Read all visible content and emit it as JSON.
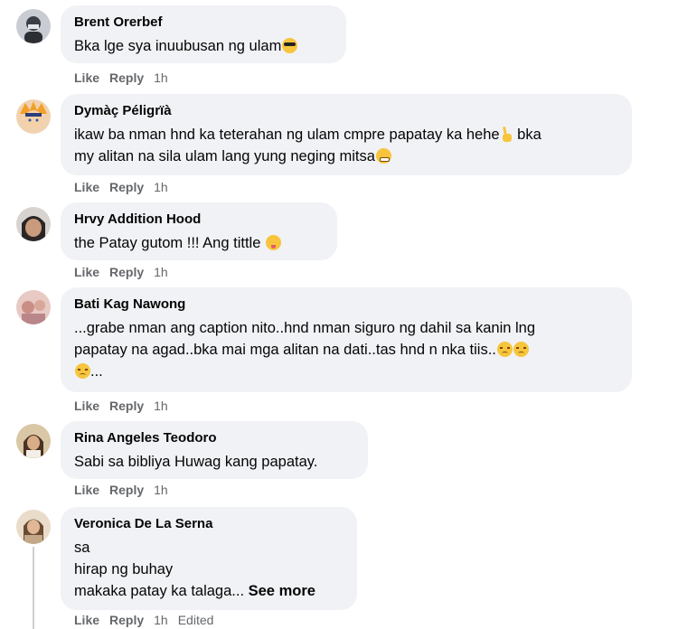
{
  "colors": {
    "bubble": "#f0f2f5",
    "meta": "#65676b",
    "text": "#050505"
  },
  "comments": [
    {
      "author": "Brent Orerbef",
      "lines": [
        "Bka lge sya inuubusan ng ulam"
      ],
      "emojis": [
        "smiling-face-with-sunglasses"
      ],
      "like": "Like",
      "reply": "Reply",
      "time": "1h"
    },
    {
      "author": "Dymàç Péligrïà",
      "lines": [
        "ikaw ba nman hnd ka teterahan ng ulam cmpre papatay ka hehe",
        " bka",
        "my alitan na sila ulam lang yung neging mitsa"
      ],
      "emojis": [
        "victory-hand",
        "grinning-face"
      ],
      "like": "Like",
      "reply": "Reply",
      "time": "1h"
    },
    {
      "author": "Hrvy Addition Hood",
      "lines": [
        "the Patay gutom !!! Ang tittle"
      ],
      "emojis": [
        "face-savoring-food"
      ],
      "like": "Like",
      "reply": "Reply",
      "time": "1h"
    },
    {
      "author": "Bati Kag Nawong",
      "lines": [
        "...grabe nman ang caption nito..hnd nman siguro ng dahil sa kanin lng",
        "papatay na agad..bka mai mga alitan na dati..tas hnd n nka tiis..",
        "..."
      ],
      "emojis": [
        "pensive-face",
        "pensive-face",
        "pensive-face"
      ],
      "like": "Like",
      "reply": "Reply",
      "time": "1h"
    },
    {
      "author": "Rina Angeles Teodoro",
      "lines": [
        "Sabi sa bibliya Huwag kang papatay."
      ],
      "like": "Like",
      "reply": "Reply",
      "time": "1h"
    },
    {
      "author": "Veronica De La Serna",
      "lines": [
        "sa",
        "hirap ng buhay",
        "makaka patay ka talaga..."
      ],
      "see_more": "See more",
      "like": "Like",
      "reply": "Reply",
      "time": "1h",
      "edited": "Edited"
    }
  ]
}
